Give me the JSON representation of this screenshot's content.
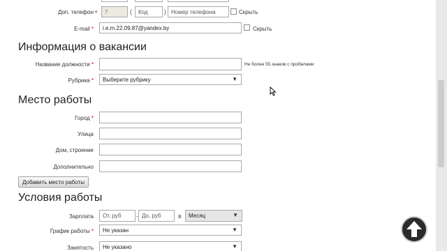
{
  "contacts": {
    "phone_label": "Доп. телефон",
    "plus": "+",
    "country_code": "7",
    "open_paren": "(",
    "area_placeholder": "Код",
    "close_paren": ")",
    "number_placeholder": "Номер телефона",
    "hide_phone_label": "Скрыть",
    "email_label": "E-mail",
    "email_value": "i.e.m.22.09.87@yandex.by",
    "hide_email_label": "Скрыть"
  },
  "vacancy": {
    "heading": "Информация о вакансии",
    "title_label": "Название должности",
    "title_hint": "Не более 55 знаков с пробелами",
    "rubric_label": "Рубрика",
    "rubric_value": "Выберите рубрику"
  },
  "workplace": {
    "heading": "Место работы",
    "city_label": "Город",
    "street_label": "Улица",
    "building_label": "Дом, строение",
    "extra_label": "Дополнительно",
    "add_button": "Добавить место работы"
  },
  "conditions": {
    "heading": "Условия работы",
    "salary_label": "Зарплата",
    "salary_from_placeholder": "От, руб",
    "dash": "-",
    "salary_to_placeholder": "До, руб",
    "per": "в",
    "period_value": "Месяц",
    "schedule_label": "График работы",
    "schedule_value": "Не указан",
    "employment_label": "Занятость",
    "employment_value": "Не указано"
  },
  "required_mark": "*",
  "icons": {
    "dropdown": "chevron-down-icon",
    "scroll_top": "arrow-up-icon",
    "cursor": "mouse-cursor-icon"
  }
}
